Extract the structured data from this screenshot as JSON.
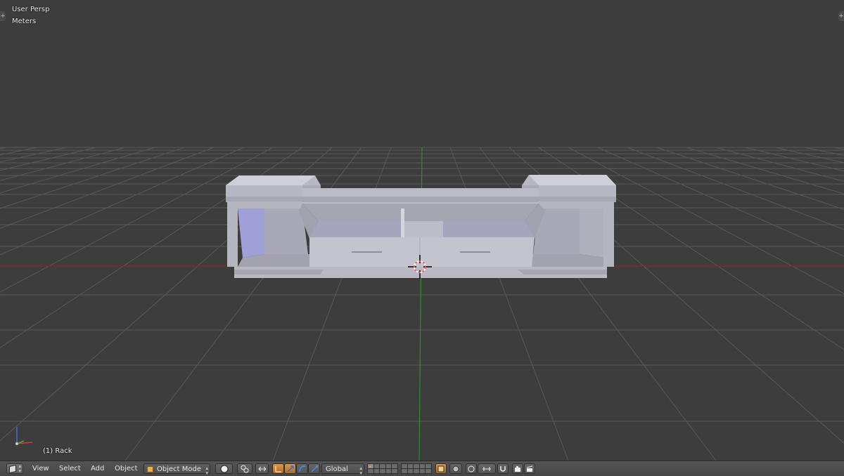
{
  "viewport": {
    "view_name": "User Persp",
    "units": "Meters",
    "active_object": "(1) Rack",
    "colors": {
      "background": "#3d3d3d",
      "grid": "#5a5a5a",
      "x_axis": "#8a2020",
      "y_axis": "#2a8a2a",
      "model": "#c0c0c8",
      "model_shade": "#9d9dab"
    }
  },
  "header": {
    "menu": {
      "view": "View",
      "select": "Select",
      "add": "Add",
      "object": "Object"
    },
    "mode": "Object Mode",
    "orientation": "Global",
    "icons": {
      "editor_type": "cube-icon",
      "shading": "sphere-icon",
      "pivot": "pivot-icon",
      "manipulator": "manipulator-icon",
      "translate": "translate-arrow-icon",
      "rotate": "rotate-arc-icon",
      "scale": "scale-icon",
      "render": "render-icon",
      "snap": "magnet-icon",
      "camera": "camera-icon"
    }
  }
}
